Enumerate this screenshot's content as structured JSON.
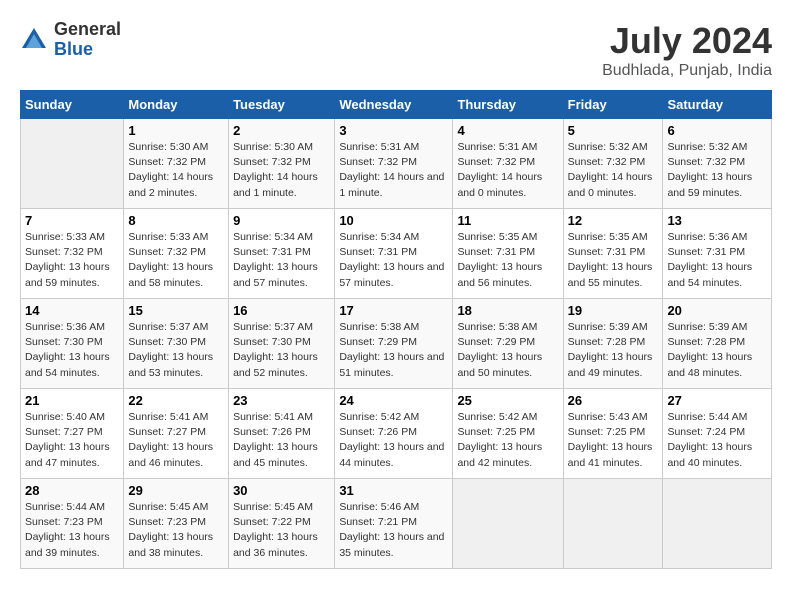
{
  "header": {
    "logo_general": "General",
    "logo_blue": "Blue",
    "title": "July 2024",
    "subtitle": "Budhlada, Punjab, India"
  },
  "calendar": {
    "days_of_week": [
      "Sunday",
      "Monday",
      "Tuesday",
      "Wednesday",
      "Thursday",
      "Friday",
      "Saturday"
    ],
    "weeks": [
      [
        {
          "day": "",
          "empty": true
        },
        {
          "day": "1",
          "sunrise": "Sunrise: 5:30 AM",
          "sunset": "Sunset: 7:32 PM",
          "daylight": "Daylight: 14 hours and 2 minutes."
        },
        {
          "day": "2",
          "sunrise": "Sunrise: 5:30 AM",
          "sunset": "Sunset: 7:32 PM",
          "daylight": "Daylight: 14 hours and 1 minute."
        },
        {
          "day": "3",
          "sunrise": "Sunrise: 5:31 AM",
          "sunset": "Sunset: 7:32 PM",
          "daylight": "Daylight: 14 hours and 1 minute."
        },
        {
          "day": "4",
          "sunrise": "Sunrise: 5:31 AM",
          "sunset": "Sunset: 7:32 PM",
          "daylight": "Daylight: 14 hours and 0 minutes."
        },
        {
          "day": "5",
          "sunrise": "Sunrise: 5:32 AM",
          "sunset": "Sunset: 7:32 PM",
          "daylight": "Daylight: 14 hours and 0 minutes."
        },
        {
          "day": "6",
          "sunrise": "Sunrise: 5:32 AM",
          "sunset": "Sunset: 7:32 PM",
          "daylight": "Daylight: 13 hours and 59 minutes."
        }
      ],
      [
        {
          "day": "7",
          "sunrise": "Sunrise: 5:33 AM",
          "sunset": "Sunset: 7:32 PM",
          "daylight": "Daylight: 13 hours and 59 minutes."
        },
        {
          "day": "8",
          "sunrise": "Sunrise: 5:33 AM",
          "sunset": "Sunset: 7:32 PM",
          "daylight": "Daylight: 13 hours and 58 minutes."
        },
        {
          "day": "9",
          "sunrise": "Sunrise: 5:34 AM",
          "sunset": "Sunset: 7:31 PM",
          "daylight": "Daylight: 13 hours and 57 minutes."
        },
        {
          "day": "10",
          "sunrise": "Sunrise: 5:34 AM",
          "sunset": "Sunset: 7:31 PM",
          "daylight": "Daylight: 13 hours and 57 minutes."
        },
        {
          "day": "11",
          "sunrise": "Sunrise: 5:35 AM",
          "sunset": "Sunset: 7:31 PM",
          "daylight": "Daylight: 13 hours and 56 minutes."
        },
        {
          "day": "12",
          "sunrise": "Sunrise: 5:35 AM",
          "sunset": "Sunset: 7:31 PM",
          "daylight": "Daylight: 13 hours and 55 minutes."
        },
        {
          "day": "13",
          "sunrise": "Sunrise: 5:36 AM",
          "sunset": "Sunset: 7:31 PM",
          "daylight": "Daylight: 13 hours and 54 minutes."
        }
      ],
      [
        {
          "day": "14",
          "sunrise": "Sunrise: 5:36 AM",
          "sunset": "Sunset: 7:30 PM",
          "daylight": "Daylight: 13 hours and 54 minutes."
        },
        {
          "day": "15",
          "sunrise": "Sunrise: 5:37 AM",
          "sunset": "Sunset: 7:30 PM",
          "daylight": "Daylight: 13 hours and 53 minutes."
        },
        {
          "day": "16",
          "sunrise": "Sunrise: 5:37 AM",
          "sunset": "Sunset: 7:30 PM",
          "daylight": "Daylight: 13 hours and 52 minutes."
        },
        {
          "day": "17",
          "sunrise": "Sunrise: 5:38 AM",
          "sunset": "Sunset: 7:29 PM",
          "daylight": "Daylight: 13 hours and 51 minutes."
        },
        {
          "day": "18",
          "sunrise": "Sunrise: 5:38 AM",
          "sunset": "Sunset: 7:29 PM",
          "daylight": "Daylight: 13 hours and 50 minutes."
        },
        {
          "day": "19",
          "sunrise": "Sunrise: 5:39 AM",
          "sunset": "Sunset: 7:28 PM",
          "daylight": "Daylight: 13 hours and 49 minutes."
        },
        {
          "day": "20",
          "sunrise": "Sunrise: 5:39 AM",
          "sunset": "Sunset: 7:28 PM",
          "daylight": "Daylight: 13 hours and 48 minutes."
        }
      ],
      [
        {
          "day": "21",
          "sunrise": "Sunrise: 5:40 AM",
          "sunset": "Sunset: 7:27 PM",
          "daylight": "Daylight: 13 hours and 47 minutes."
        },
        {
          "day": "22",
          "sunrise": "Sunrise: 5:41 AM",
          "sunset": "Sunset: 7:27 PM",
          "daylight": "Daylight: 13 hours and 46 minutes."
        },
        {
          "day": "23",
          "sunrise": "Sunrise: 5:41 AM",
          "sunset": "Sunset: 7:26 PM",
          "daylight": "Daylight: 13 hours and 45 minutes."
        },
        {
          "day": "24",
          "sunrise": "Sunrise: 5:42 AM",
          "sunset": "Sunset: 7:26 PM",
          "daylight": "Daylight: 13 hours and 44 minutes."
        },
        {
          "day": "25",
          "sunrise": "Sunrise: 5:42 AM",
          "sunset": "Sunset: 7:25 PM",
          "daylight": "Daylight: 13 hours and 42 minutes."
        },
        {
          "day": "26",
          "sunrise": "Sunrise: 5:43 AM",
          "sunset": "Sunset: 7:25 PM",
          "daylight": "Daylight: 13 hours and 41 minutes."
        },
        {
          "day": "27",
          "sunrise": "Sunrise: 5:44 AM",
          "sunset": "Sunset: 7:24 PM",
          "daylight": "Daylight: 13 hours and 40 minutes."
        }
      ],
      [
        {
          "day": "28",
          "sunrise": "Sunrise: 5:44 AM",
          "sunset": "Sunset: 7:23 PM",
          "daylight": "Daylight: 13 hours and 39 minutes."
        },
        {
          "day": "29",
          "sunrise": "Sunrise: 5:45 AM",
          "sunset": "Sunset: 7:23 PM",
          "daylight": "Daylight: 13 hours and 38 minutes."
        },
        {
          "day": "30",
          "sunrise": "Sunrise: 5:45 AM",
          "sunset": "Sunset: 7:22 PM",
          "daylight": "Daylight: 13 hours and 36 minutes."
        },
        {
          "day": "31",
          "sunrise": "Sunrise: 5:46 AM",
          "sunset": "Sunset: 7:21 PM",
          "daylight": "Daylight: 13 hours and 35 minutes."
        },
        {
          "day": "",
          "empty": true
        },
        {
          "day": "",
          "empty": true
        },
        {
          "day": "",
          "empty": true
        }
      ]
    ]
  }
}
